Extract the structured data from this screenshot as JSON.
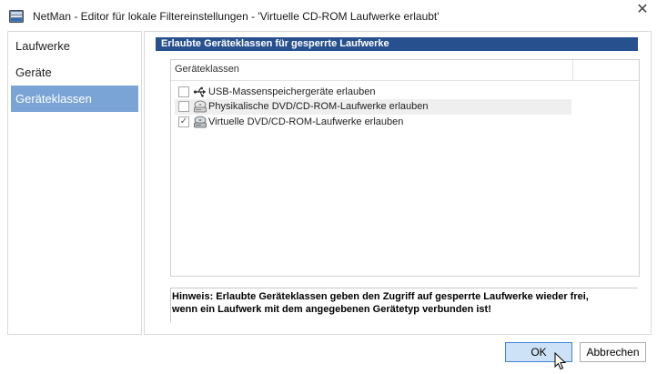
{
  "window": {
    "title": "NetMan - Editor für lokale Filtereinstellungen - 'Virtuelle CD-ROM Laufwerke erlaubt'",
    "close_glyph": "✕"
  },
  "sidebar": {
    "items": [
      {
        "label": "Laufwerke",
        "selected": false
      },
      {
        "label": "Geräte",
        "selected": false
      },
      {
        "label": "Geräteklassen",
        "selected": true
      }
    ]
  },
  "section": {
    "header": "Erlaubte Geräteklassen für gesperrte Laufwerke"
  },
  "grid": {
    "column_header": "Geräteklassen",
    "rows": [
      {
        "label": "USB-Massenspeichergeräte erlauben",
        "checked": false,
        "icon": "usb-icon"
      },
      {
        "label": "Physikalische DVD/CD-ROM-Laufwerke erlauben",
        "checked": false,
        "icon": "cd-drive-icon"
      },
      {
        "label": "Virtuelle DVD/CD-ROM-Laufwerke erlauben",
        "checked": true,
        "icon": "virtual-cd-drive-icon"
      }
    ]
  },
  "hint": {
    "line1": "Hinweis: Erlaubte Geräteklassen geben den Zugriff auf gesperrte Laufwerke wieder frei,",
    "line2": "wenn ein Laufwerk mit dem angegebenen Gerätetyp verbunden ist!"
  },
  "buttons": {
    "ok_label": "OK",
    "cancel_label": "Abbrechen"
  },
  "colors": {
    "accent": "#27508f",
    "selection": "#7aa4d6",
    "ok_button_bg": "#cde1f7"
  }
}
